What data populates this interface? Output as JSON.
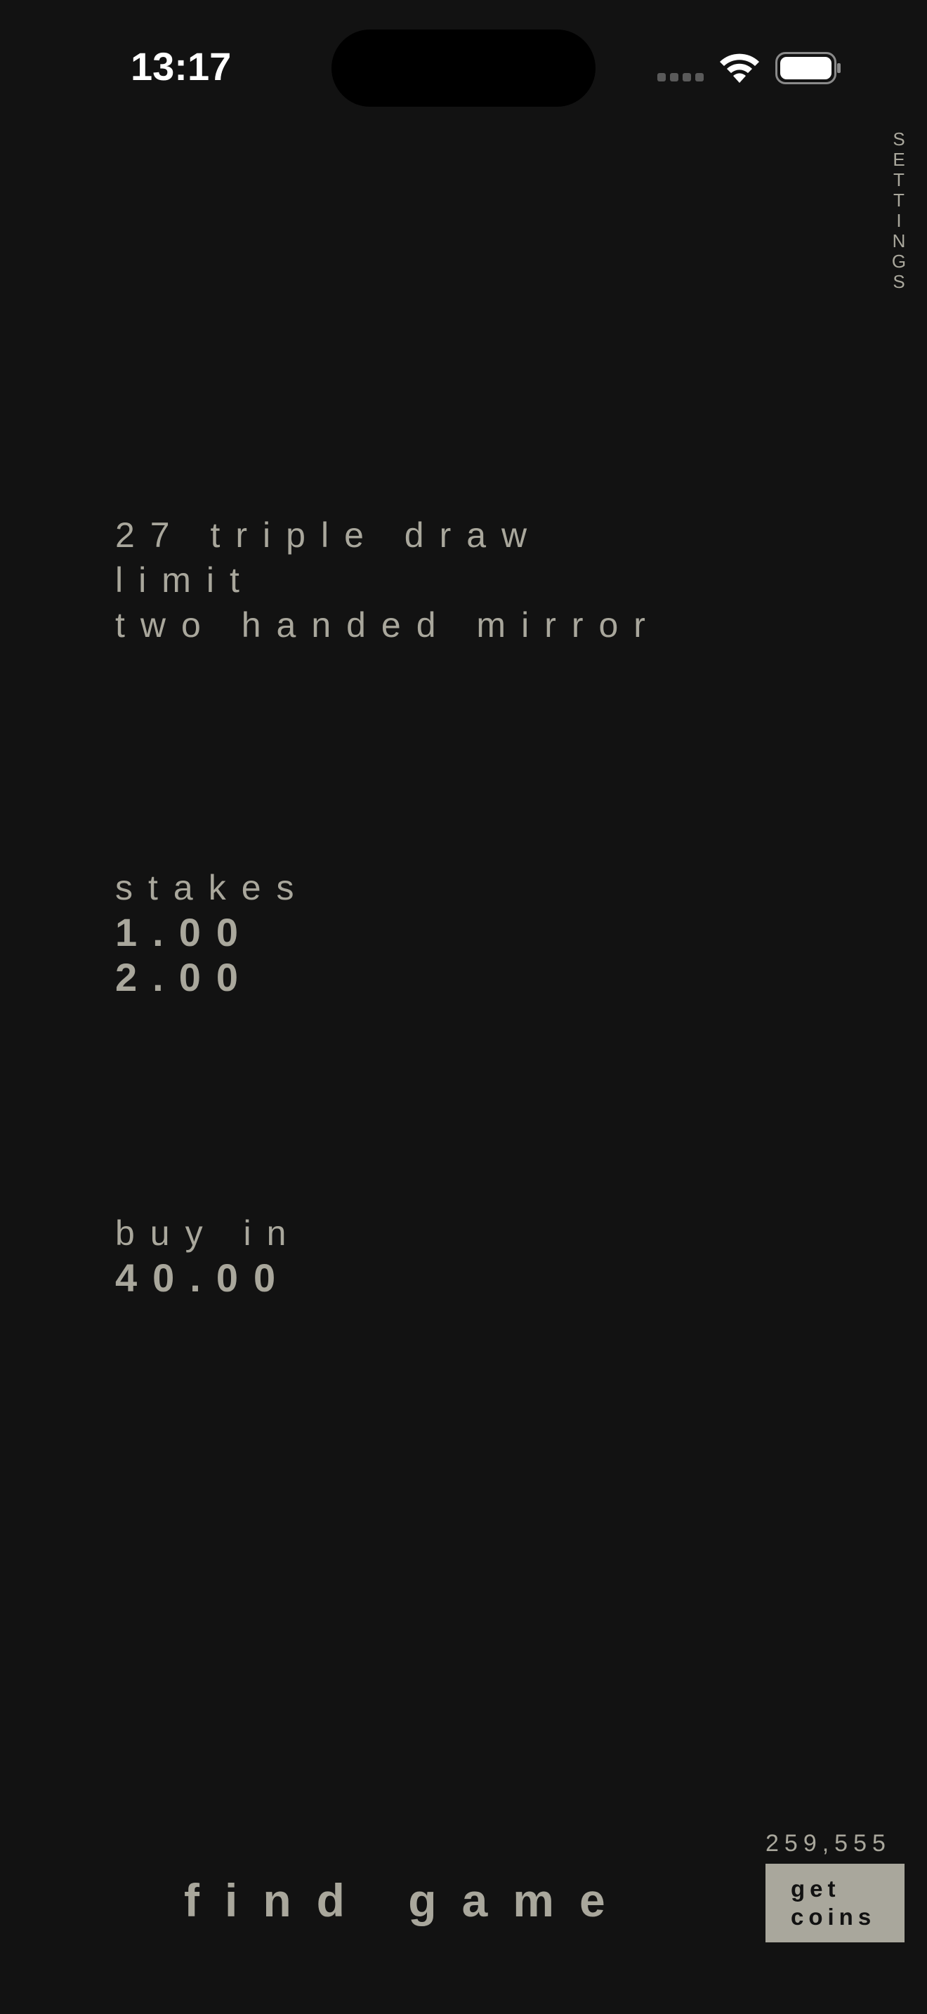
{
  "status_bar": {
    "time": "13:17"
  },
  "settings": {
    "label": "SETTINGS"
  },
  "game": {
    "line1": "27 triple draw",
    "line2": "limit",
    "line3": "two handed mirror"
  },
  "stakes": {
    "label": "stakes",
    "small": "1.00",
    "big": "2.00"
  },
  "buy_in": {
    "label": "buy in",
    "value": "40.00"
  },
  "wallet": {
    "balance": "259,555",
    "get_coins_line1": "get",
    "get_coins_line2": "coins"
  },
  "actions": {
    "find_game_label": "find game"
  },
  "colors": {
    "background": "#121212",
    "text": "#a9a79c",
    "button_bg": "#a9a79c"
  },
  "icons": {
    "signal": "cellular-signal-icon",
    "wifi": "wifi-icon",
    "battery": "battery-icon"
  }
}
